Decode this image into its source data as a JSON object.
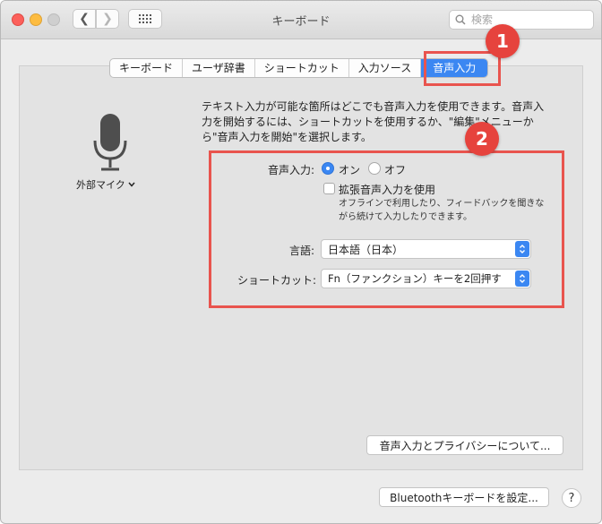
{
  "window": {
    "title": "キーボード"
  },
  "search": {
    "placeholder": "検索"
  },
  "tabs": [
    {
      "label": "キーボード"
    },
    {
      "label": "ユーザ辞書"
    },
    {
      "label": "ショートカット"
    },
    {
      "label": "入力ソース"
    },
    {
      "label": "音声入力",
      "active": true
    }
  ],
  "annotations": {
    "one": "1",
    "two": "2"
  },
  "mic": {
    "label": "外部マイク"
  },
  "description": "テキスト入力が可能な箇所はどこでも音声入力を使用できます。音声入力を開始するには、ショートカットを使用するか、\"編集\"メニューから\"音声入力を開始\"を選択します。",
  "dictation": {
    "label": "音声入力:",
    "on_label": "オン",
    "off_label": "オフ",
    "selected": "on"
  },
  "enhanced": {
    "label": "拡張音声入力を使用",
    "checked": false,
    "note": "オフラインで利用したり、フィードバックを聞きながら続けて入力したりできます。"
  },
  "language": {
    "label": "言語:",
    "value": "日本語（日本）"
  },
  "shortcut": {
    "label": "ショートカット:",
    "value": "Fn（ファンクション）キーを2回押す"
  },
  "privacy_button": "音声入力とプライバシーについて...",
  "bluetooth_button": "Bluetoothキーボードを設定...",
  "help_button": "?",
  "colors": {
    "accent": "#3b87f2",
    "annotation": "#e6433d"
  }
}
